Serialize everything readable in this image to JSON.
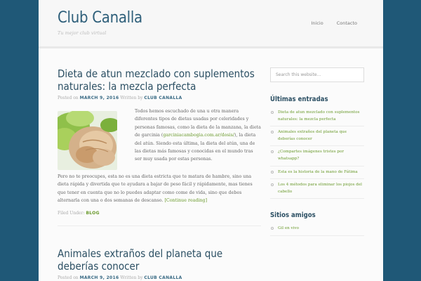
{
  "header": {
    "site_title": "Club Canalla",
    "site_description": "Tu mejor club virtual",
    "nav": [
      "Inicio",
      "Contacto"
    ]
  },
  "posts": [
    {
      "title": "Dieta de atun mezclado con suplementos naturales: la mezcla perfecta",
      "meta_prefix": "Posted on",
      "date": "MARCH 9, 2016",
      "meta_by": "Written by",
      "author": "CLUB CANALLA",
      "para1_a": "Todos hemos escuchado de una u otra manera diferentes tipos de dietas usadas por celeridades y personas famosas, como la dieta de la manzana, la dieta de garcinia (",
      "para1_link": "garciniacambogia.com.ar/dosis/",
      "para1_b": "), la dieta del atún. Siendo esta última, la dieta del atún, una de las dietas más famosas y conocidas en el mundo tras ser muy usada por estas personas.",
      "para2": "Pero no te preocupes, esta no es una dieta estricta que te matara de hambre, sino una dieta rápida y divertida que te ayudara a bajar de peso fácil y rápidamente, mas tienes que tener en cuenta que no lo puedes adaptar como come de vida, sino que debes alternarla con una o dos semanas de descanso.",
      "continue": "[Continue reading]",
      "filed_label": "Filed Under:",
      "category": "BLOG"
    },
    {
      "title": "Animales extraños del planeta que deberías conocer",
      "meta_prefix": "Posted on",
      "date": "MARCH 9, 2016",
      "meta_by": "Written by",
      "author": "CLUB CANALLA"
    }
  ],
  "sidebar": {
    "search_placeholder": "Search this website…",
    "recent_title": "Últimas entradas",
    "recent": [
      "Dieta de atun mezclado con suplementos naturales: la mezcla perfecta",
      "Animales extraños del planeta que deberías conocer",
      "¿Compartes imágenes tristes por whatsapp?",
      "Esta es la historia de la mano de Fátima",
      "Los 4 métodos para eliminar los piojos del cabello"
    ],
    "friends_title": "Sitios amigos",
    "friends": [
      "Gil en vivo"
    ]
  },
  "colors": {
    "page_bg": "#1f5877",
    "title": "#2e5f7a",
    "link_green": "#6a9a2c"
  }
}
